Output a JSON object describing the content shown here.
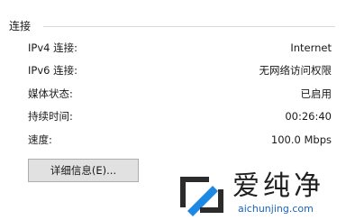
{
  "section": {
    "title": "连接"
  },
  "rows": [
    {
      "label": "IPv4 连接:",
      "value": "Internet"
    },
    {
      "label": "IPv6 连接:",
      "value": "无网络访问权限"
    },
    {
      "label": "媒体状态:",
      "value": "已启用"
    },
    {
      "label": "持续时间:",
      "value": "00:26:40"
    },
    {
      "label": "速度:",
      "value": "100.0 Mbps"
    }
  ],
  "buttons": {
    "details_label": "详细信息(E)..."
  },
  "watermark": {
    "brand_text": "爱纯净",
    "url_text": "aichunjing.com",
    "colors": {
      "logo_blue": "#1e88e5",
      "logo_dark": "#2b2b2b",
      "url": "#1565c0"
    }
  }
}
